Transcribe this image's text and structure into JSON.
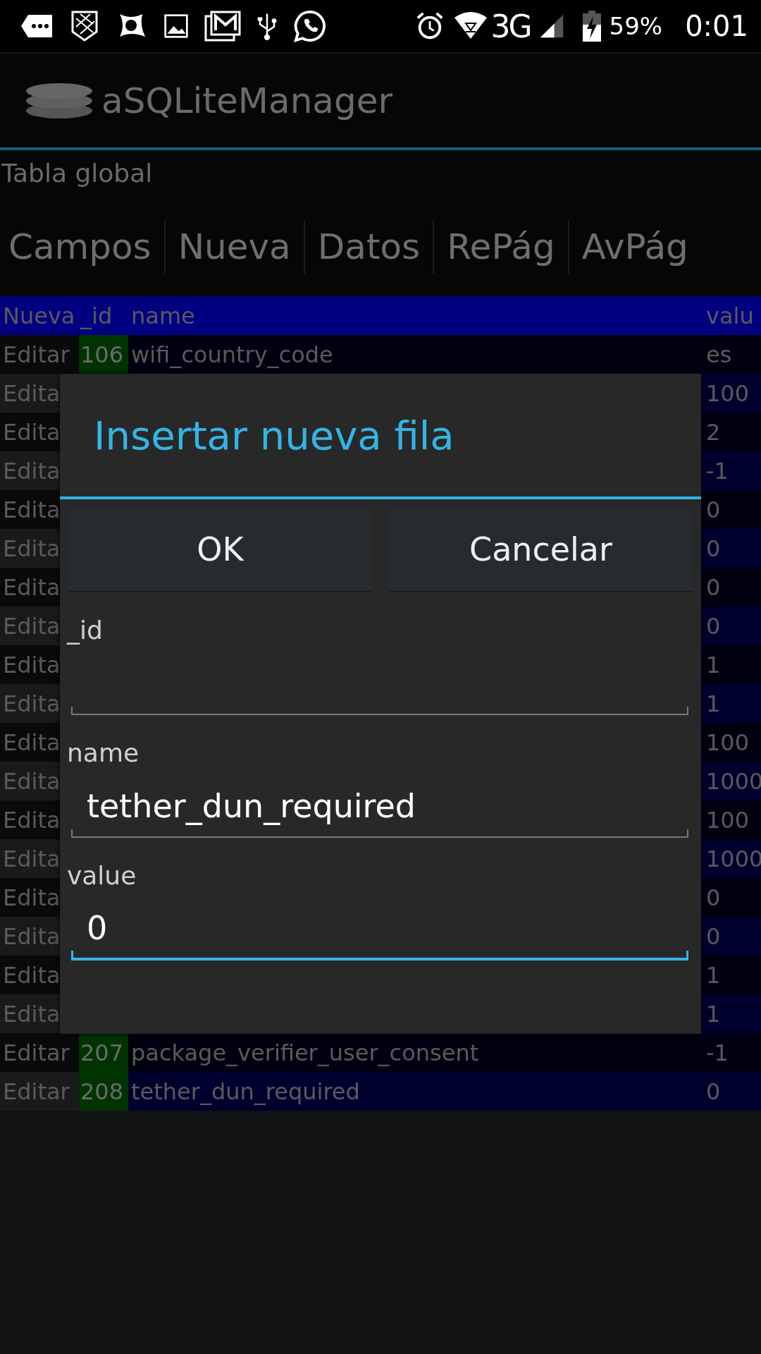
{
  "status_bar": {
    "network": "3G",
    "battery": "59%",
    "time": "0:01"
  },
  "app_bar": {
    "title": "aSQLiteManager"
  },
  "table_title": "Tabla global",
  "tabs": [
    "Campos",
    "Nueva",
    "Datos",
    "RePág",
    "AvPág"
  ],
  "table": {
    "columns": [
      "Nueva",
      "_id",
      "name",
      "valu"
    ],
    "rows": [
      {
        "action": "Editar",
        "id": "106",
        "name": "wifi_country_code",
        "value": "es"
      },
      {
        "action": "Edita",
        "value": "100"
      },
      {
        "action": "Edita",
        "value": "2"
      },
      {
        "action": "Edita",
        "value": "-1"
      },
      {
        "action": "Edita",
        "value": "0"
      },
      {
        "action": "Edita",
        "value": "0"
      },
      {
        "action": "Edita",
        "value": "0"
      },
      {
        "action": "Edita",
        "value": "0"
      },
      {
        "action": "Edita",
        "value": "1"
      },
      {
        "action": "Edita",
        "value": "1"
      },
      {
        "action": "Edita",
        "value": "100"
      },
      {
        "action": "Edita",
        "value": "1000"
      },
      {
        "action": "Edita",
        "value": "100"
      },
      {
        "action": "Edita",
        "value": "1000"
      },
      {
        "action": "Edita",
        "value": "0"
      },
      {
        "action": "Edita",
        "value": "0"
      },
      {
        "action": "Edita",
        "value": "1"
      },
      {
        "action": "Edita",
        "value": "1"
      },
      {
        "action": "Editar",
        "id": "207",
        "name": "package_verifier_user_consent",
        "value": "-1"
      },
      {
        "action": "Editar",
        "id": "208",
        "name": "tether_dun_required",
        "value": "0"
      }
    ]
  },
  "dialog": {
    "title": "Insertar nueva fila",
    "buttons": [
      "OK",
      "Cancelar"
    ],
    "fields": [
      {
        "label": "_id",
        "focused": false
      },
      {
        "label": "name",
        "value": "tether_dun_required",
        "focused": false
      },
      {
        "label": "value",
        "value": "0",
        "focused": true
      }
    ]
  }
}
